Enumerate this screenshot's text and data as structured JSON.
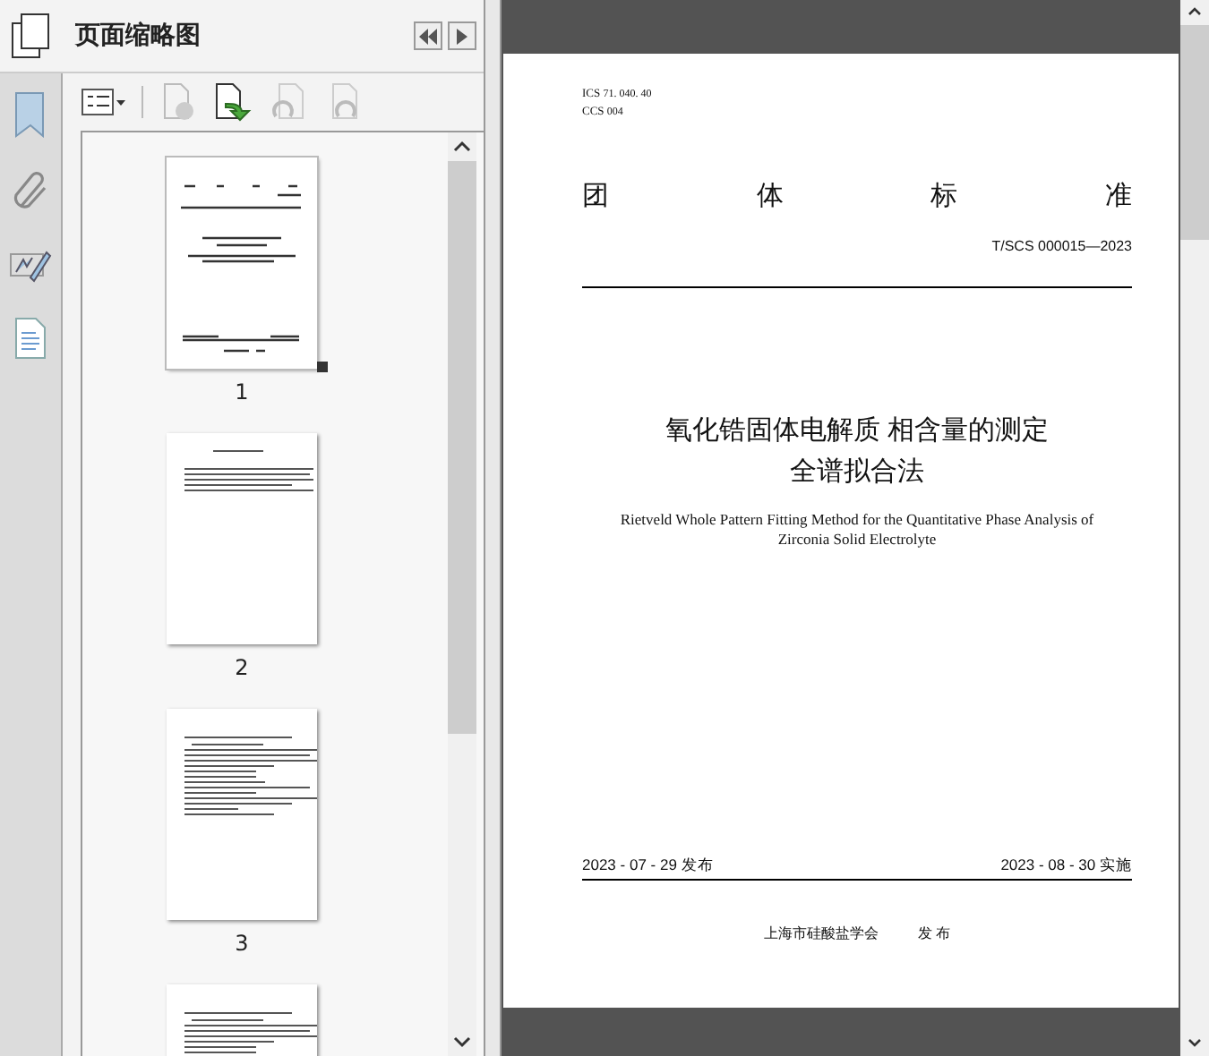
{
  "panel": {
    "title": "页面缩略图"
  },
  "thumbnails": [
    {
      "page": "1",
      "selected": true,
      "kind": "cover"
    },
    {
      "page": "2",
      "selected": false,
      "kind": "preface"
    },
    {
      "page": "3",
      "selected": false,
      "kind": "list"
    },
    {
      "kind": "list",
      "selected": false
    }
  ],
  "document": {
    "ics": "ICS",
    "ics_code": "71. 040. 40",
    "ccs": "CCS",
    "ccs_code": "004",
    "heading": [
      "团",
      "体",
      "标",
      "准"
    ],
    "number": "T/SCS 000015—2023",
    "title_lines": [
      "氧化锆固体电解质 相含量的测定",
      "全谱拟合法"
    ],
    "english_title": "Rietveld Whole Pattern Fitting Method for the Quantitative Phase Analysis of Zirconia Solid Electrolyte",
    "issue_date": "2023 - 07 - 29 发布",
    "effective_date": "2023 - 08 - 30 实施",
    "publisher": "上海市硅酸盐学会",
    "publish_word": "发 布"
  }
}
